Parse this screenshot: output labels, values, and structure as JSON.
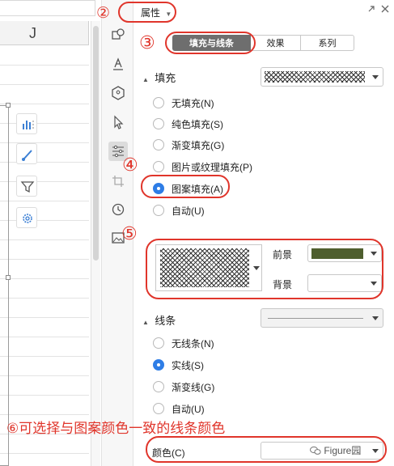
{
  "sheet": {
    "column_letter": "J"
  },
  "panel": {
    "title": "属性"
  },
  "tabs": [
    {
      "label": "填充与线条"
    },
    {
      "label": "效果"
    },
    {
      "label": "系列"
    }
  ],
  "fill": {
    "section_label": "填充",
    "options": [
      {
        "label": "无填充(N)",
        "selected": false
      },
      {
        "label": "纯色填充(S)",
        "selected": false
      },
      {
        "label": "渐变填充(G)",
        "selected": false
      },
      {
        "label": "图片或纹理填充(P)",
        "selected": false
      },
      {
        "label": "图案填充(A)",
        "selected": true
      },
      {
        "label": "自动(U)",
        "selected": false
      }
    ],
    "foreground_label": "前景",
    "foreground_color": "#4e5e2e",
    "background_label": "背景",
    "background_color": "#ffffff"
  },
  "line": {
    "section_label": "线条",
    "options": [
      {
        "label": "无线条(N)",
        "selected": false
      },
      {
        "label": "实线(S)",
        "selected": true
      },
      {
        "label": "渐变线(G)",
        "selected": false
      },
      {
        "label": "自动(U)",
        "selected": false
      }
    ],
    "color_label": "颜色(C)"
  },
  "annotations": {
    "n2": "②",
    "n3": "③",
    "n4": "④",
    "n5": "⑤",
    "n6_text": "⑥可选择与图案颜色一致的线条颜色"
  },
  "watermark": "Figure园",
  "colors": {
    "accent_red": "#e0352b",
    "radio_blue": "#2e7de6",
    "tab_active": "#6e6e6e"
  },
  "icons": [
    "pin-icon",
    "close-icon",
    "bar-chart-icon",
    "brush-icon",
    "filter-icon",
    "settings-icon",
    "shapes-icon",
    "text-style-icon",
    "shape-effects-icon",
    "cursor-icon",
    "sliders-icon",
    "crop-icon",
    "history-icon",
    "image-icon"
  ]
}
